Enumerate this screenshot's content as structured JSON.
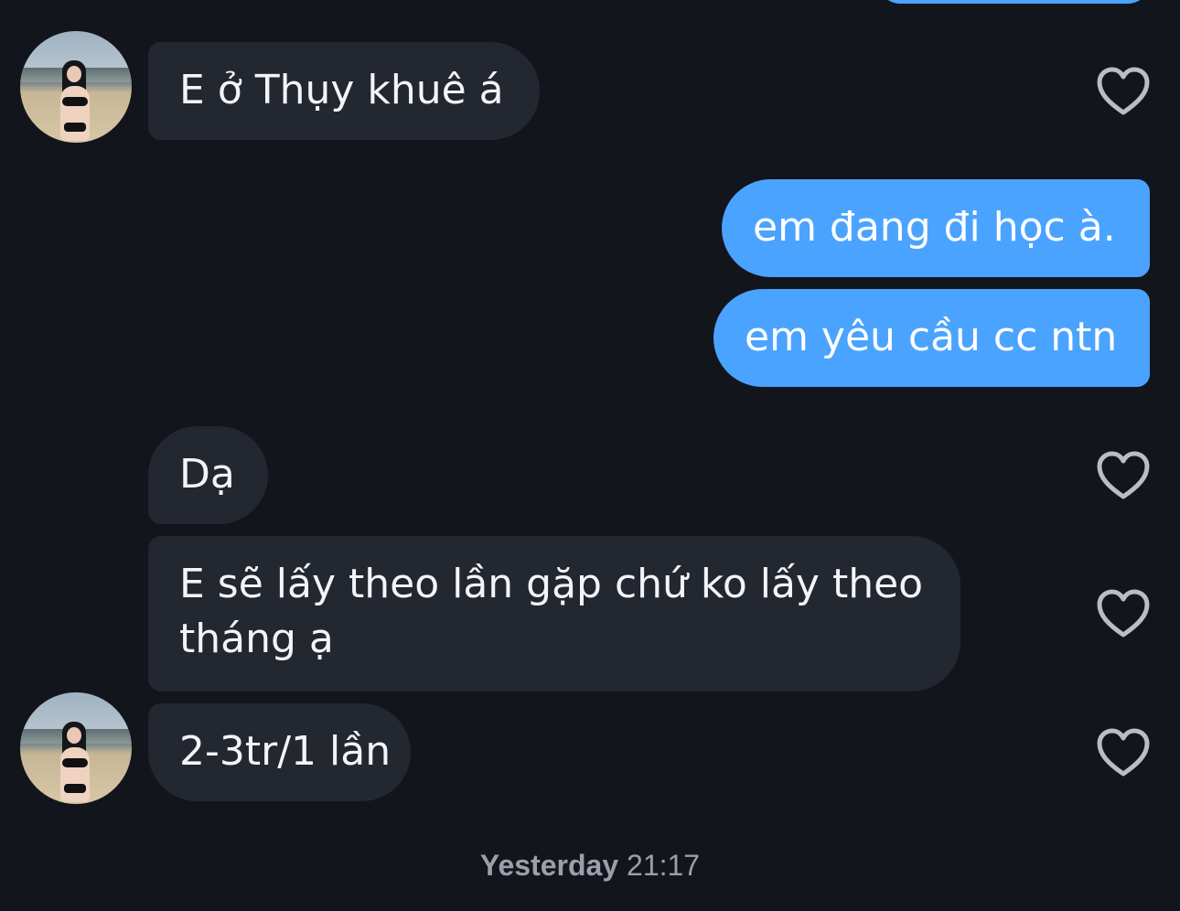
{
  "messages": [
    {
      "id": "m1",
      "direction": "in",
      "text": "E ở Thụy khuê á",
      "avatar": true,
      "liked": false
    },
    {
      "id": "m2",
      "direction": "out",
      "text": "em đang đi học à."
    },
    {
      "id": "m3",
      "direction": "out",
      "text": "em yêu cầu cc ntn"
    },
    {
      "id": "m4",
      "direction": "in",
      "text": "Dạ",
      "avatar": false,
      "liked": false
    },
    {
      "id": "m5",
      "direction": "in",
      "text": "E sẽ lấy theo lần gặp chứ ko lấy theo",
      "text_line2": "tháng ạ",
      "avatar": false,
      "liked": false
    },
    {
      "id": "m6",
      "direction": "in",
      "text": "2-3tr/1 lần",
      "avatar": true,
      "liked": false
    }
  ],
  "timestamp": {
    "day": "Yesterday",
    "time": "21:17"
  },
  "colors": {
    "background": "#12151b",
    "incoming_bubble": "#232730",
    "outgoing_bubble": "#4aa3ff",
    "heart_outline": "#b9bdc4",
    "timestamp_text": "#9aa0aa"
  },
  "icons": {
    "like": "heart-outline-icon"
  }
}
